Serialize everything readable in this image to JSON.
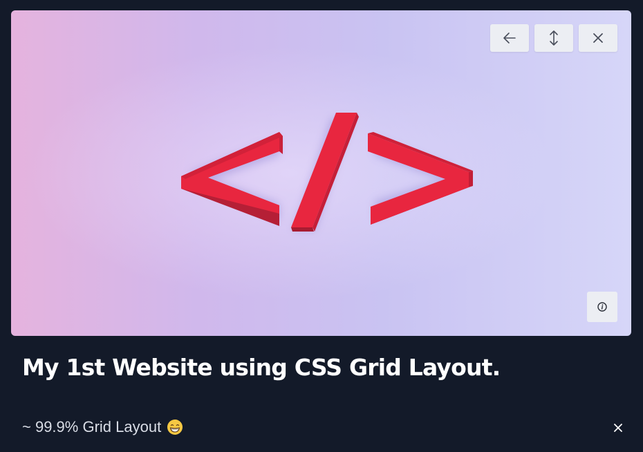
{
  "lightbox": {
    "toolbar": {
      "back_icon": "arrow-left-icon",
      "expand_icon": "arrows-vertical-icon",
      "close_icon": "close-icon"
    },
    "image": {
      "subject": "code-brackets-icon",
      "accent_color": "#e8263f"
    },
    "info_icon": "info-icon"
  },
  "caption": {
    "title": "My 1st Website using CSS Grid Layout.",
    "description": "~ 99.9% Grid Layout",
    "emoji": "grinning-face-emoji"
  },
  "colors": {
    "background": "#131a29",
    "button_bg": "#eceef3",
    "title": "#ffffff",
    "description": "#d9dde6"
  }
}
